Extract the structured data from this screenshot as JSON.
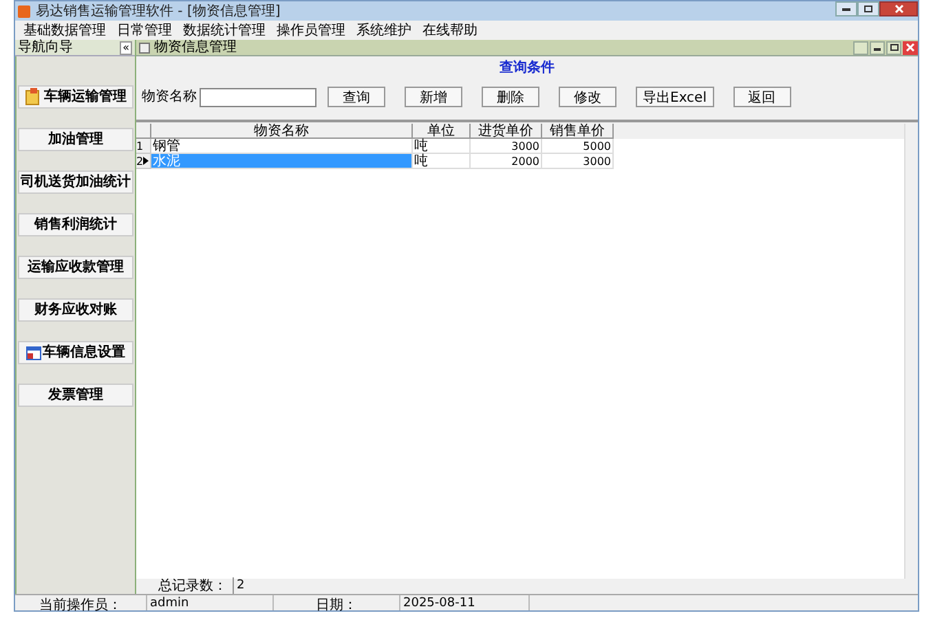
{
  "window": {
    "title": "易达销售运输管理软件 - [物资信息管理]"
  },
  "menu": [
    "基础数据管理",
    "日常管理",
    "数据统计管理",
    "操作员管理",
    "系统维护",
    "在线帮助"
  ],
  "nav": {
    "title": "导航向导",
    "collapse": "«"
  },
  "child_window": {
    "title": "物资信息管理"
  },
  "sidebar": {
    "items": [
      {
        "label": "车辆运输管理",
        "kind": "icon"
      },
      {
        "label": "加油管理",
        "kind": "plain"
      },
      {
        "label": "司机送货加油统计",
        "kind": "plain"
      },
      {
        "label": "销售利润统计",
        "kind": "plain"
      },
      {
        "label": "运输应收款管理",
        "kind": "plain"
      },
      {
        "label": "财务应收对账",
        "kind": "plain"
      },
      {
        "label": "车辆信息设置",
        "kind": "icon2"
      },
      {
        "label": "发票管理",
        "kind": "plain"
      }
    ]
  },
  "query": {
    "title": "查询条件",
    "field_label": "物资名称",
    "buttons": [
      "查询",
      "新增",
      "删除",
      "修改",
      "导出Excel",
      "返回"
    ]
  },
  "table": {
    "columns": [
      "物资名称",
      "单位",
      "进货单价",
      "销售单价"
    ],
    "rows": [
      {
        "index": "1",
        "cells": [
          "钢管",
          "吨",
          "3000",
          "5000"
        ],
        "selected": false
      },
      {
        "index": "2",
        "cells": [
          "水泥",
          "吨",
          "2000",
          "3000"
        ],
        "selected": true
      }
    ]
  },
  "footer": {
    "label": "总记录数：",
    "value": "2"
  },
  "status_bar": {
    "operator_label": "当前操作员：",
    "operator": "admin",
    "date_label": "日期：",
    "date": "2025-08-11"
  }
}
